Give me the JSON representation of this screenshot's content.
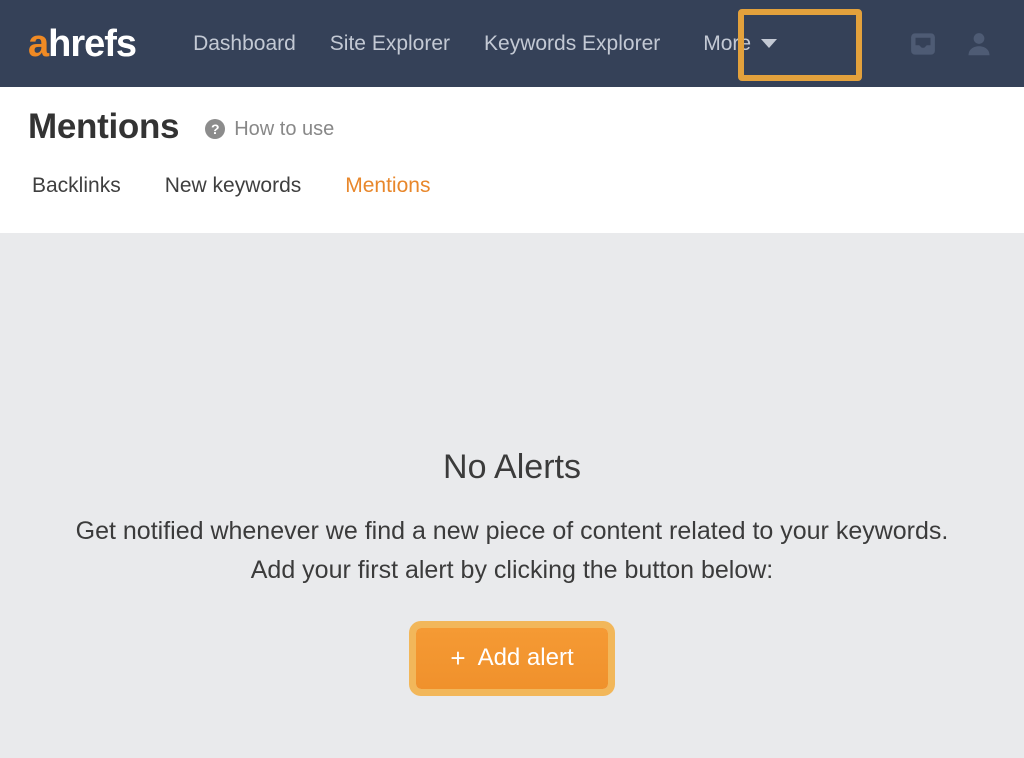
{
  "navbar": {
    "logo": {
      "accent_letter": "a",
      "rest": "hrefs",
      "accent_color": "#f08a24"
    },
    "links": [
      {
        "label": "Dashboard",
        "name": "nav-link-dashboard"
      },
      {
        "label": "Site Explorer",
        "name": "nav-link-site-explorer"
      },
      {
        "label": "Keywords Explorer",
        "name": "nav-link-keywords-explorer"
      }
    ],
    "more": {
      "label": "More",
      "icon": "chevron-down-icon",
      "highlighted": true
    },
    "icons": [
      {
        "name": "inbox-icon"
      },
      {
        "name": "user-account-icon"
      }
    ],
    "background_color": "#354158"
  },
  "header": {
    "title": "Mentions",
    "how_to_use": {
      "label": "How to use",
      "icon": "question-mark-circle-icon"
    },
    "tabs": [
      {
        "label": "Backlinks",
        "active": false
      },
      {
        "label": "New keywords",
        "active": false
      },
      {
        "label": "Mentions",
        "active": true
      }
    ],
    "active_tab_color": "#e8872b",
    "highlight_color": "#f2b75a"
  },
  "main": {
    "empty_title": "No Alerts",
    "empty_desc_line1": "Get notified whenever we find a new piece of content related to your keywords.",
    "empty_desc_line2": "Add your first alert by clicking the button below:",
    "add_alert_button": {
      "plus": "+",
      "label": "Add alert",
      "color": "#f0912c"
    },
    "background_color": "#e9eaec"
  }
}
